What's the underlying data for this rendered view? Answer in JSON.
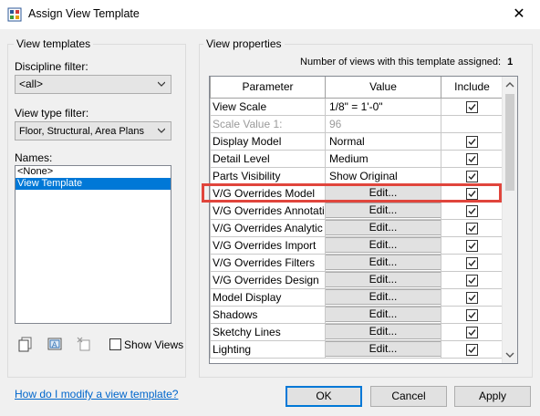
{
  "window": {
    "title": "Assign View Template",
    "close": "✕"
  },
  "left_panel": {
    "group_label": "View templates",
    "discipline_filter_label": "Discipline filter:",
    "discipline_filter_value": "<all>",
    "view_type_filter_label": "View type filter:",
    "view_type_filter_value": "Floor, Structural, Area Plans",
    "names_label": "Names:",
    "names": [
      "<None>",
      "View Template"
    ],
    "selected_index": 1,
    "show_views_label": "Show Views"
  },
  "right_panel": {
    "group_label": "View properties",
    "views_count_label": "Number of views with this template assigned:",
    "views_count_value": "1",
    "columns": [
      "Parameter",
      "Value",
      "Include"
    ],
    "rows": [
      {
        "param": "View Scale",
        "value": "1/8\" = 1'-0\"",
        "type": "text",
        "include": true
      },
      {
        "param": "Scale Value    1:",
        "value": "96",
        "type": "disabled",
        "include": null
      },
      {
        "param": "Display Model",
        "value": "Normal",
        "type": "text",
        "include": true
      },
      {
        "param": "Detail Level",
        "value": "Medium",
        "type": "text",
        "include": true
      },
      {
        "param": "Parts Visibility",
        "value": "Show Original",
        "type": "text",
        "include": true
      },
      {
        "param": "V/G Overrides Model",
        "value": "Edit...",
        "type": "button",
        "include": true
      },
      {
        "param": "V/G Overrides Annotati",
        "value": "Edit...",
        "type": "button",
        "include": true
      },
      {
        "param": "V/G Overrides Analytic",
        "value": "Edit...",
        "type": "button",
        "include": true
      },
      {
        "param": "V/G Overrides Import",
        "value": "Edit...",
        "type": "button",
        "include": true
      },
      {
        "param": "V/G Overrides Filters",
        "value": "Edit...",
        "type": "button",
        "include": true
      },
      {
        "param": "V/G Overrides Design",
        "value": "Edit...",
        "type": "button",
        "include": true
      },
      {
        "param": "Model Display",
        "value": "Edit...",
        "type": "button",
        "include": true
      },
      {
        "param": "Shadows",
        "value": "Edit...",
        "type": "button",
        "include": true
      },
      {
        "param": "Sketchy Lines",
        "value": "Edit...",
        "type": "button",
        "include": true
      },
      {
        "param": "Lighting",
        "value": "Edit...",
        "type": "button",
        "include": true
      }
    ]
  },
  "footer": {
    "help_link": "How do I modify a view template?",
    "ok": "OK",
    "cancel": "Cancel",
    "apply": "Apply"
  },
  "colors": {
    "highlight": "#e0453c",
    "accent": "#0078d7"
  }
}
